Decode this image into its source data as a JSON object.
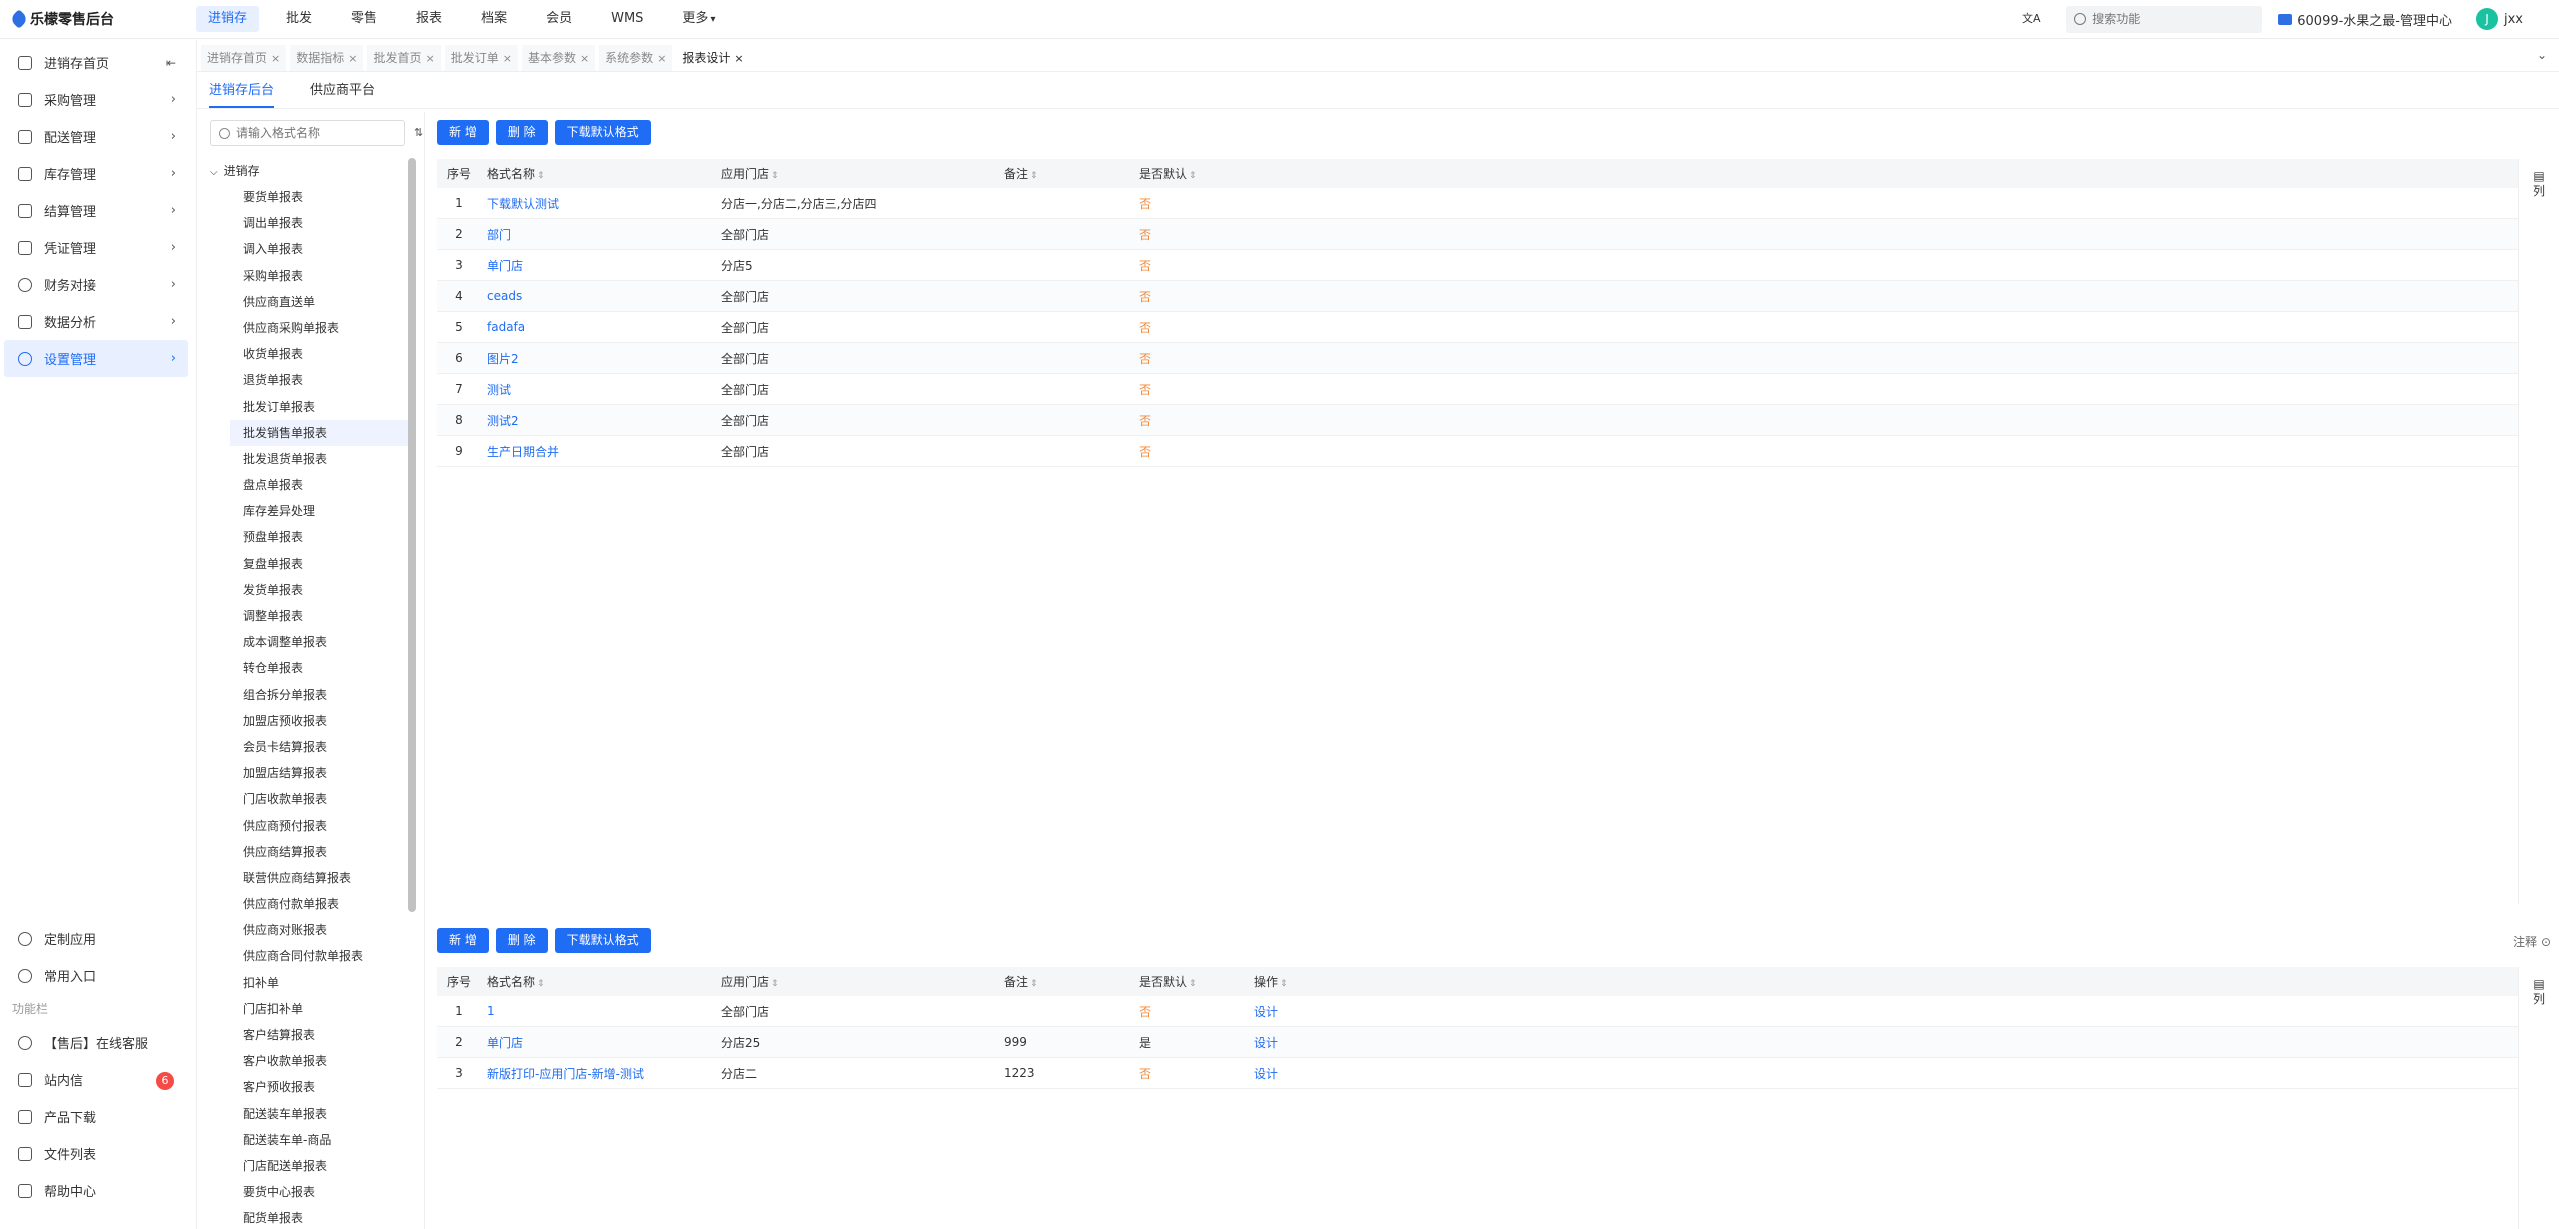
{
  "header": {
    "brand": "乐檬零售后台",
    "nav": [
      "进销存",
      "批发",
      "零售",
      "报表",
      "档案",
      "会员",
      "WMS",
      "更多"
    ],
    "nav_more_caret": "▾",
    "search_placeholder": "搜索功能",
    "store": "60099-水果之最-管理中心",
    "user_initial": "J",
    "user_name": "jxx",
    "translate_glyph": "文A",
    "accent": "#1f6cf5"
  },
  "sidebar": {
    "items": [
      {
        "label": "进销存首页",
        "icon": "home-icon"
      },
      {
        "label": "采购管理",
        "icon": "cart-icon"
      },
      {
        "label": "配送管理",
        "icon": "truck-icon"
      },
      {
        "label": "库存管理",
        "icon": "box-icon"
      },
      {
        "label": "结算管理",
        "icon": "yen-icon"
      },
      {
        "label": "凭证管理",
        "icon": "voucher-icon"
      },
      {
        "label": "财务对接",
        "icon": "finance-icon"
      },
      {
        "label": "数据分析",
        "icon": "chart-icon"
      },
      {
        "label": "设置管理",
        "icon": "settings-icon"
      }
    ],
    "bottom": {
      "custom_app": "定制应用",
      "common_entry": "常用入口",
      "section_label": "功能栏",
      "support": "【售后】在线客服",
      "inbox": "站内信",
      "inbox_count": "6",
      "download": "产品下载",
      "files": "文件列表",
      "help": "帮助中心"
    }
  },
  "tabs": [
    {
      "label": "进销存首页",
      "active": false
    },
    {
      "label": "数据指标",
      "active": false
    },
    {
      "label": "批发首页",
      "active": false
    },
    {
      "label": "批发订单",
      "active": false
    },
    {
      "label": "基本参数",
      "active": false
    },
    {
      "label": "系统参数",
      "active": false
    },
    {
      "label": "报表设计",
      "active": true
    }
  ],
  "close_glyph": "×",
  "subtabs": [
    "进销存后台",
    "供应商平台"
  ],
  "tree": {
    "search_placeholder": "请输入格式名称",
    "root": "进销存",
    "items": [
      "要货单报表",
      "调出单报表",
      "调入单报表",
      "采购单报表",
      "供应商直送单",
      "供应商采购单报表",
      "收货单报表",
      "退货单报表",
      "批发订单报表",
      "批发销售单报表",
      "批发退货单报表",
      "盘点单报表",
      "库存差异处理",
      "预盘单报表",
      "复盘单报表",
      "发货单报表",
      "调整单报表",
      "成本调整单报表",
      "转仓单报表",
      "组合拆分单报表",
      "加盟店预收报表",
      "会员卡结算报表",
      "加盟店结算报表",
      "门店收款单报表",
      "供应商预付报表",
      "供应商结算报表",
      "联营供应商结算报表",
      "供应商付款单报表",
      "供应商对账报表",
      "供应商合同付款单报表",
      "扣补单",
      "门店扣补单",
      "客户结算报表",
      "客户收款单报表",
      "客户预收报表",
      "配送装车单报表",
      "配送装车单-商品",
      "门店配送单报表",
      "要货中心报表",
      "配货单报表"
    ],
    "selected_index": 9
  },
  "buttons": {
    "add": "新 增",
    "delete": "删 除",
    "download": "下载默认格式"
  },
  "table1": {
    "headers": {
      "no": "序号",
      "name": "格式名称",
      "store": "应用门店",
      "note": "备注",
      "default": "是否默认"
    },
    "rows": [
      {
        "no": "1",
        "name": "下载默认测试",
        "store": "分店一,分店二,分店三,分店四",
        "note": "",
        "default": "否"
      },
      {
        "no": "2",
        "name": "部门",
        "store": "全部门店",
        "note": "",
        "default": "否"
      },
      {
        "no": "3",
        "name": "单门店",
        "store": "分店5",
        "note": "",
        "default": "否"
      },
      {
        "no": "4",
        "name": "ceads",
        "store": "全部门店",
        "note": "",
        "default": "否"
      },
      {
        "no": "5",
        "name": "fadafa",
        "store": "全部门店",
        "note": "",
        "default": "否"
      },
      {
        "no": "6",
        "name": "图片2",
        "store": "全部门店",
        "note": "",
        "default": "否"
      },
      {
        "no": "7",
        "name": "测试",
        "store": "全部门店",
        "note": "",
        "default": "否"
      },
      {
        "no": "8",
        "name": "测试2",
        "store": "全部门店",
        "note": "",
        "default": "否"
      },
      {
        "no": "9",
        "name": "生产日期合并",
        "store": "全部门店",
        "note": "",
        "default": "否"
      }
    ]
  },
  "table2": {
    "headers": {
      "no": "序号",
      "name": "格式名称",
      "store": "应用门店",
      "note": "备注",
      "default": "是否默认",
      "op": "操作"
    },
    "rows": [
      {
        "no": "1",
        "name": "1",
        "store": "全部门店",
        "note": "",
        "default": "否",
        "op": "设计"
      },
      {
        "no": "2",
        "name": "单门店",
        "store": "分店25",
        "note": "999",
        "default": "是",
        "op": "设计"
      },
      {
        "no": "3",
        "name": "新版打印-应用门店-新增-测试",
        "store": "分店二",
        "note": "1223",
        "default": "否",
        "op": "设计"
      }
    ]
  },
  "column_config": "列",
  "annotation": "注释"
}
